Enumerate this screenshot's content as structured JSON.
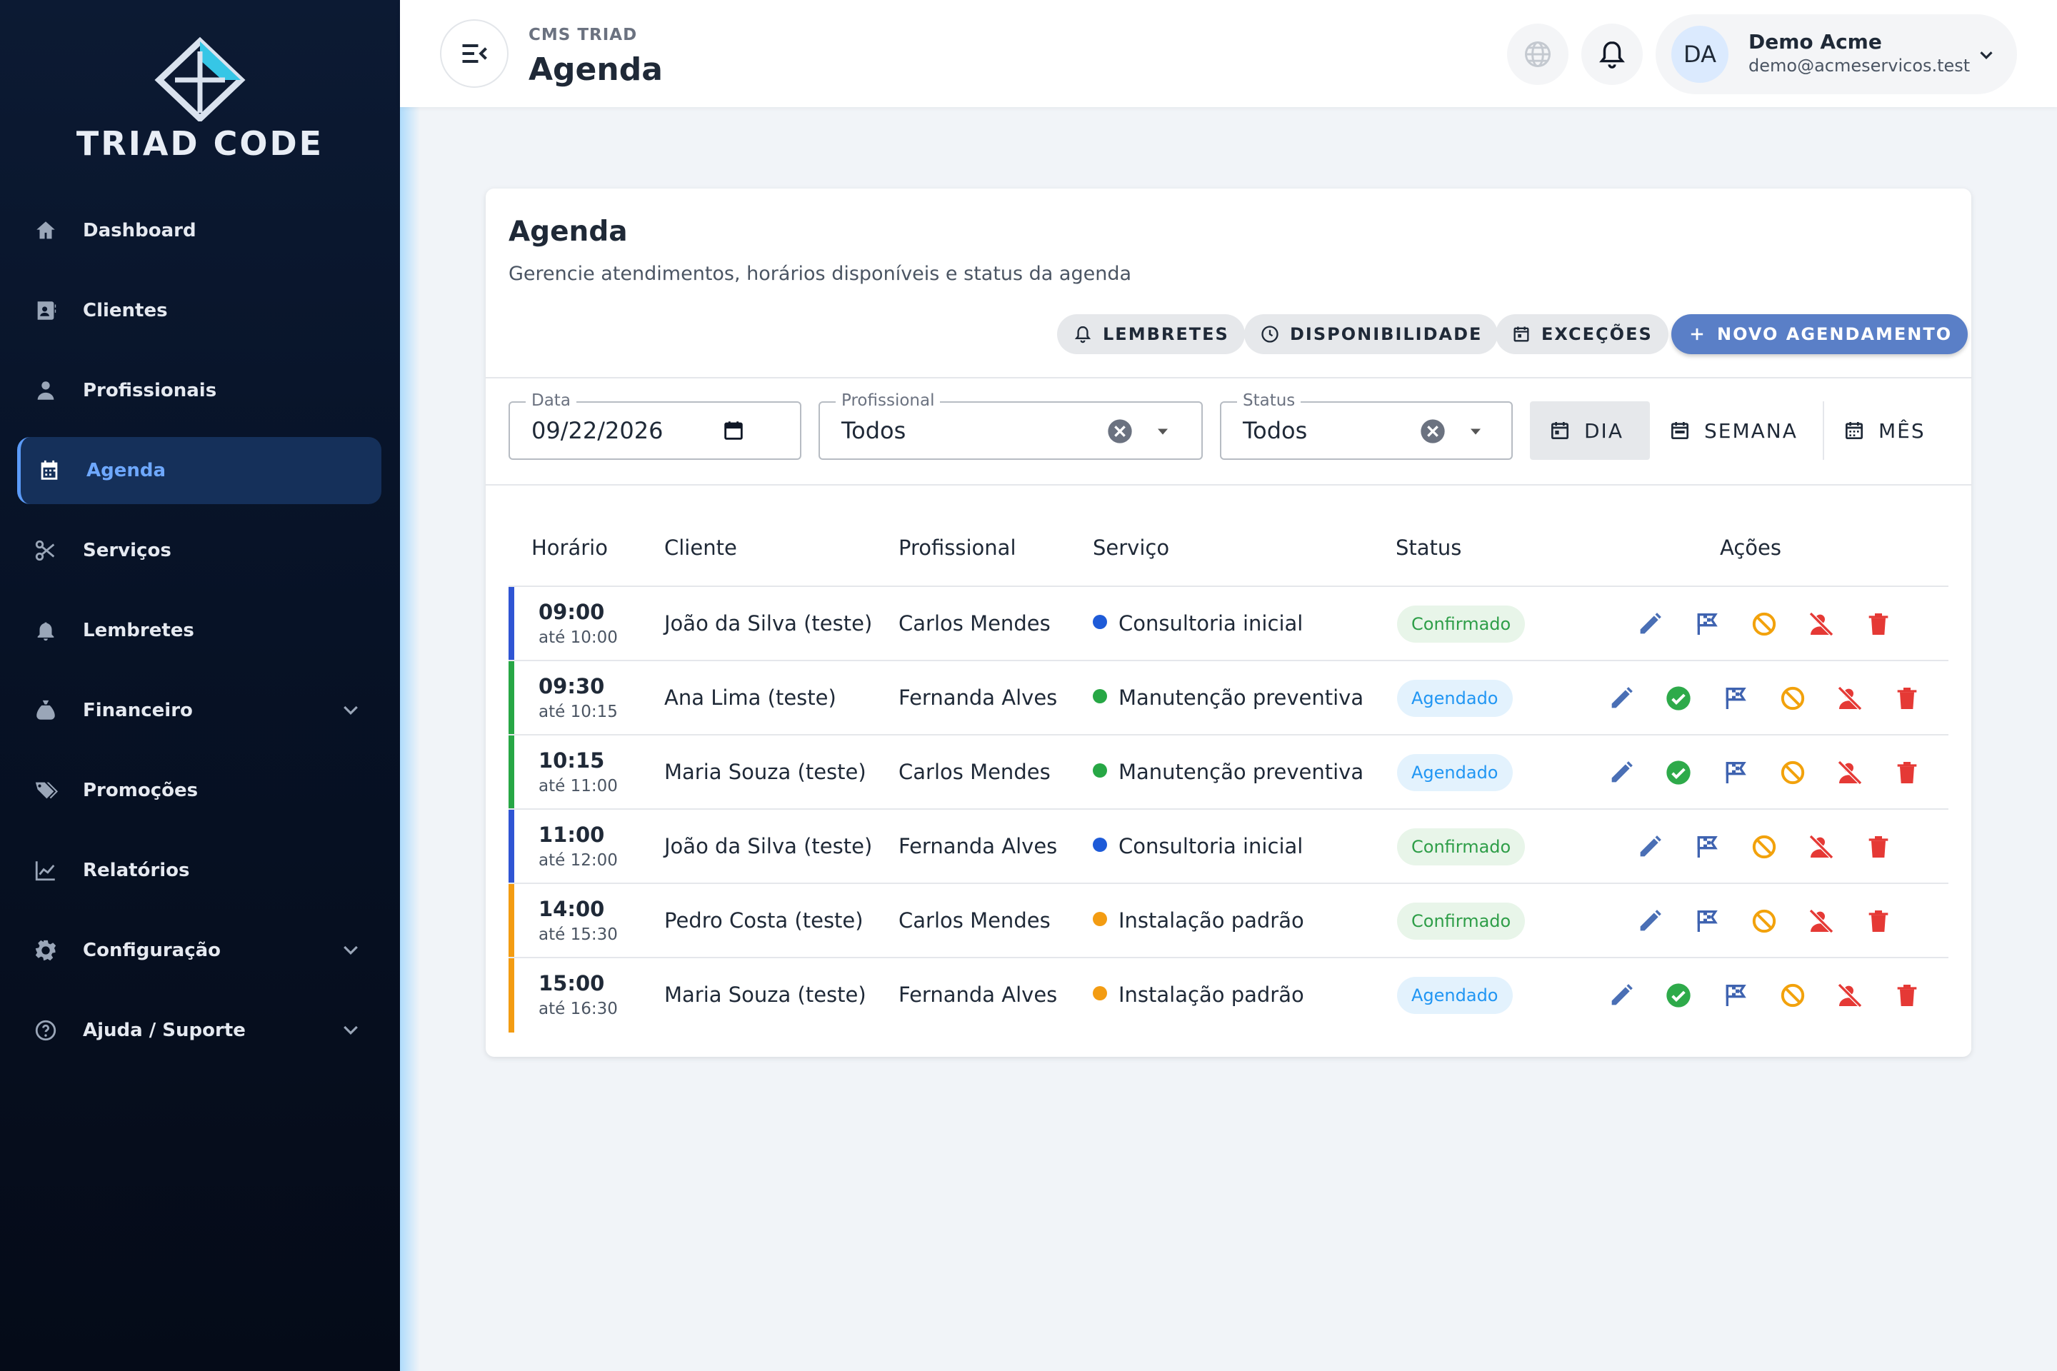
{
  "brand": {
    "logo_text": "TRIAD CODE"
  },
  "sidebar": {
    "items": [
      {
        "label": "Dashboard",
        "icon": "home-icon"
      },
      {
        "label": "Clientes",
        "icon": "contacts-icon"
      },
      {
        "label": "Profissionais",
        "icon": "person-icon"
      },
      {
        "label": "Agenda",
        "icon": "calendar-icon",
        "active": true
      },
      {
        "label": "Serviços",
        "icon": "scissors-icon"
      },
      {
        "label": "Lembretes",
        "icon": "bell-icon"
      },
      {
        "label": "Financeiro",
        "icon": "money-bag-icon",
        "expandable": true
      },
      {
        "label": "Promoções",
        "icon": "tags-icon"
      },
      {
        "label": "Relatórios",
        "icon": "chart-icon"
      },
      {
        "label": "Configuração",
        "icon": "gear-icon",
        "expandable": true
      },
      {
        "label": "Ajuda / Suporte",
        "icon": "help-icon",
        "expandable": true
      }
    ]
  },
  "header": {
    "breadcrumb": "CMS TRIAD",
    "title": "Agenda",
    "user": {
      "initials": "DA",
      "name": "Demo Acme",
      "email": "demo@acmeservicos.test"
    }
  },
  "card": {
    "title": "Agenda",
    "subtitle": "Gerencie atendimentos, horários disponíveis e status da agenda",
    "buttons": {
      "lembretes": "LEMBRETES",
      "disponibilidade": "DISPONIBILIDADE",
      "excecoes": "EXCEÇÕES",
      "novo": "NOVO AGENDAMENTO"
    }
  },
  "filters": {
    "data": {
      "label": "Data",
      "value": "09/22/2026"
    },
    "profissional": {
      "label": "Profissional",
      "value": "Todos"
    },
    "status": {
      "label": "Status",
      "value": "Todos"
    },
    "views": {
      "dia": "DIA",
      "semana": "SEMANA",
      "mes": "MÊS",
      "active": "dia"
    }
  },
  "table": {
    "headers": {
      "horario": "Horário",
      "cliente": "Cliente",
      "profissional": "Profissional",
      "servico": "Serviço",
      "status": "Status",
      "acoes": "Ações"
    },
    "rows": [
      {
        "start": "09:00",
        "end": "até 10:00",
        "cliente": "João da Silva (teste)",
        "profissional": "Carlos Mendes",
        "servico": "Consultoria inicial",
        "service_color": "#1e5bd8",
        "status": "Confirmado",
        "status_kind": "conf"
      },
      {
        "start": "09:30",
        "end": "até 10:15",
        "cliente": "Ana Lima (teste)",
        "profissional": "Fernanda Alves",
        "servico": "Manutenção preventiva",
        "service_color": "#27a745",
        "status": "Agendado",
        "status_kind": "ag"
      },
      {
        "start": "10:15",
        "end": "até 11:00",
        "cliente": "Maria Souza (teste)",
        "profissional": "Carlos Mendes",
        "servico": "Manutenção preventiva",
        "service_color": "#27a745",
        "status": "Agendado",
        "status_kind": "ag"
      },
      {
        "start": "11:00",
        "end": "até 12:00",
        "cliente": "João da Silva (teste)",
        "profissional": "Fernanda Alves",
        "servico": "Consultoria inicial",
        "service_color": "#1e5bd8",
        "status": "Confirmado",
        "status_kind": "conf"
      },
      {
        "start": "14:00",
        "end": "até 15:30",
        "cliente": "Pedro Costa (teste)",
        "profissional": "Carlos Mendes",
        "servico": "Instalação padrão",
        "service_color": "#f39c12",
        "status": "Confirmado",
        "status_kind": "conf"
      },
      {
        "start": "15:00",
        "end": "até 16:30",
        "cliente": "Maria Souza (teste)",
        "profissional": "Fernanda Alves",
        "servico": "Instalação padrão",
        "service_color": "#f39c12",
        "status": "Agendado",
        "status_kind": "ag"
      }
    ]
  },
  "colors": {
    "accent": "#5a7fc7",
    "edit": "#4a6fb5",
    "confirm": "#2eaa4a",
    "finish": "#3f63b0",
    "cancel": "#f2a20c",
    "noshow": "#e53935",
    "delete": "#e53935"
  }
}
